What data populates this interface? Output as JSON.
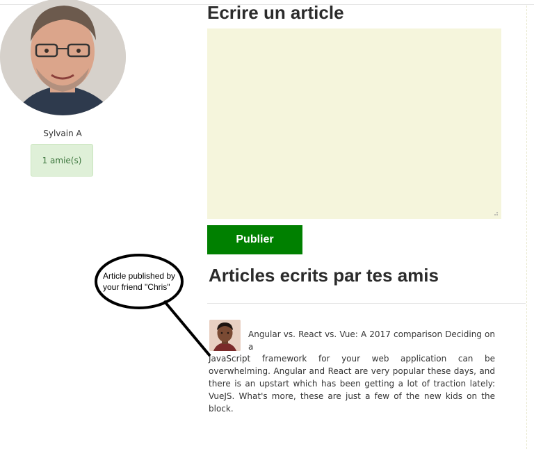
{
  "profile": {
    "name": "Sylvain A",
    "friends_count_label": "1 amie(s)"
  },
  "editor": {
    "title": "Ecrire un article",
    "textarea_value": "",
    "publish_label": "Publier",
    "background_color": "#f5f5dc",
    "button_color": "#008000"
  },
  "feed": {
    "title": "Articles ecrits par tes amis",
    "posts": [
      {
        "text_first": "Angular vs. React vs. Vue: A 2017 comparison Deciding on a",
        "text_rest": "JavaScript framework for your web application can be overwhelming. Angular and React are very popular these days, and there is an upstart which has been getting a lot of traction lately: VueJS. What's more, these are just a few of the new kids on the block."
      }
    ]
  },
  "annotation": {
    "line1": "Article published by",
    "line2": "your friend \"Chris\""
  }
}
